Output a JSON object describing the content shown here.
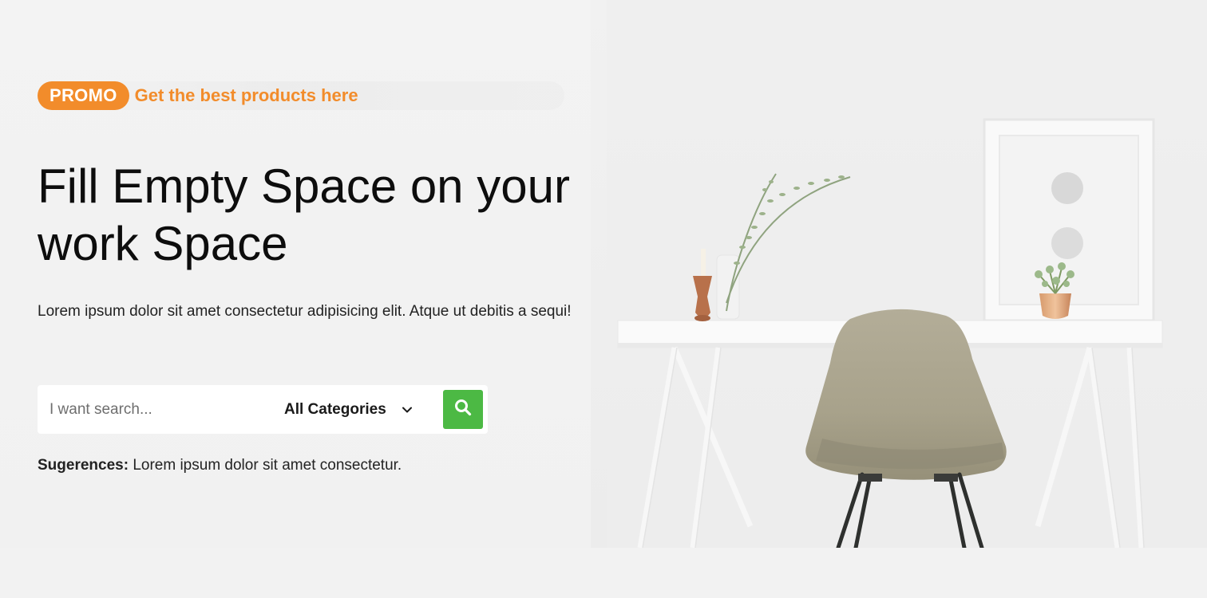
{
  "promo": {
    "badge": "PROMO",
    "text": "Get the best products here"
  },
  "hero": {
    "title": "Fill Empty Space on your work Space",
    "description": "Lorem ipsum dolor sit amet consectetur adipisicing elit. Atque ut debitis a sequi!"
  },
  "search": {
    "placeholder": "I want search...",
    "category": "All Categories",
    "button_icon": "search-icon",
    "chevron_icon": "chevron-down-icon"
  },
  "suggestions": {
    "label": "Sugerences:",
    "text": "Lorem ipsum dolor sit amet consectetur."
  },
  "colors": {
    "accent_orange": "#f28c2b",
    "search_green": "#4cb944",
    "background": "#f3f3f3"
  }
}
